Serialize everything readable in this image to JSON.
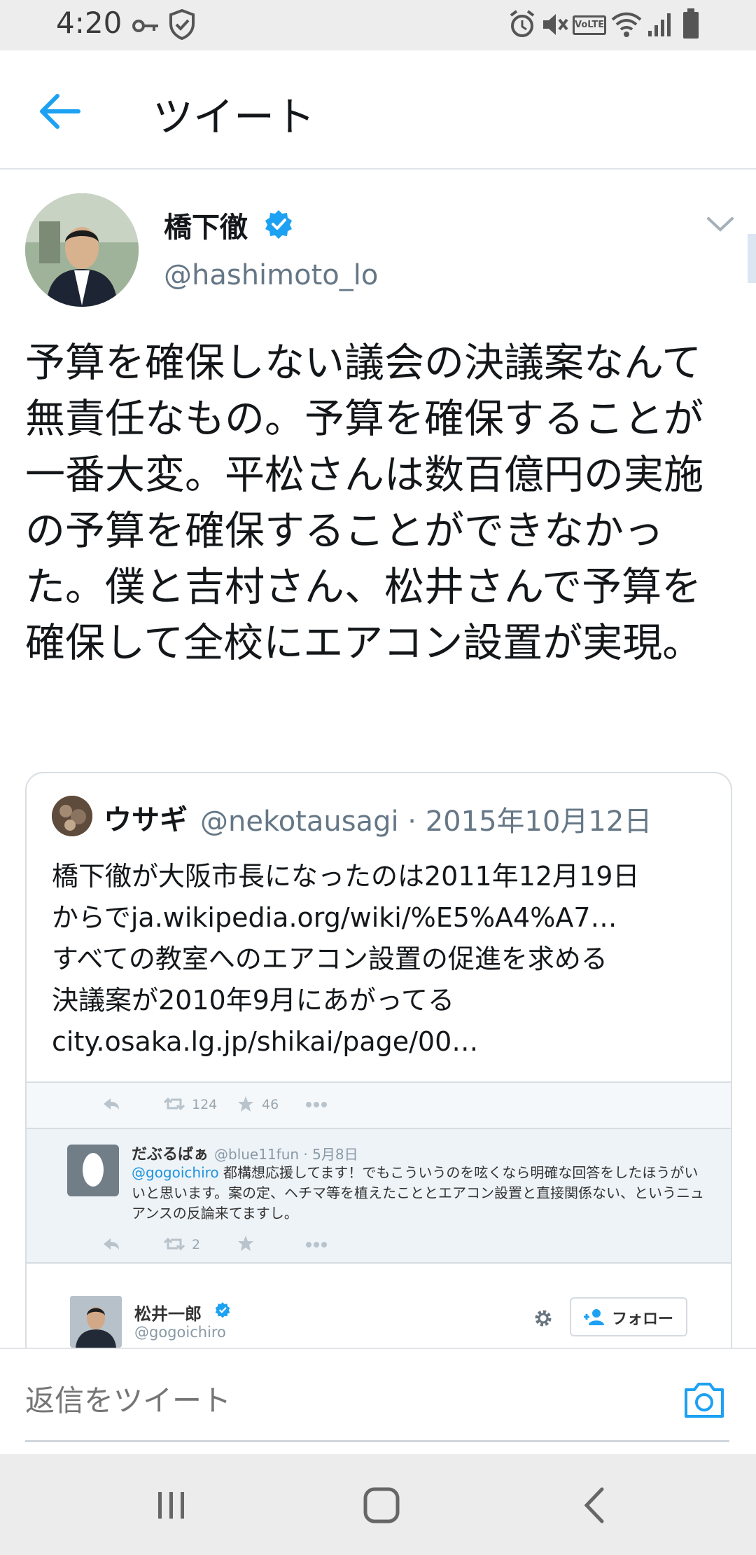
{
  "status_bar": {
    "time": "4:20",
    "icons": [
      "key-icon",
      "shield-check-icon",
      "alarm-icon",
      "mute-icon",
      "volte-icon",
      "wifi-icon",
      "signal-icon",
      "battery-icon"
    ],
    "volte_label": "VoLTE"
  },
  "app_bar": {
    "title": "ツイート",
    "back_icon": "arrow-left-icon",
    "accent": "#1da1f2"
  },
  "tweet": {
    "author_name": "橋下徹",
    "author_handle": "@hashimoto_lo",
    "verified": true,
    "text": "予算を確保しない議会の決議案なんて無責任なもの。予算を確保することが一番大変。平松さんは数百億円の実施の予算を確保することができなかった。僕と吉村さん、松井さんで予算を確保して全校にエアコン設置が実現。"
  },
  "quoted_tweet": {
    "author_name": "ウサギ",
    "meta": "@nekotausagi · 2015年10月12日",
    "text_lines": [
      "橋下徹が大阪市長になったのは2011年12月19日",
      "からでja.wikipedia.org/wiki/%E5%A4%A7…",
      "すべての教室へのエアコン設置の促進を求める",
      "決議案が2010年9月にあがってる",
      "city.osaka.lg.jp/shikai/page/00…"
    ],
    "embedded": {
      "top_actions": {
        "retweets": "124",
        "likes": "46"
      },
      "reply": {
        "name": "だぶるばぁ",
        "meta": "@blue11fun · 5月8日",
        "mention": "@gogoichiro",
        "text": " 都構想応援してます！でもこういうのを呟くなら明確な回答をしたほうがいいと思います。案の定、ヘチマ等を植えたこととエアコン設置と直接関係ない、というニュアンスの反論来てますし。",
        "retweets": "2"
      },
      "profile": {
        "name": "松井一郎",
        "handle": "@gogoichiro",
        "follow_label": "フォロー"
      }
    }
  },
  "reply_bar": {
    "placeholder": "返信をツイート"
  }
}
